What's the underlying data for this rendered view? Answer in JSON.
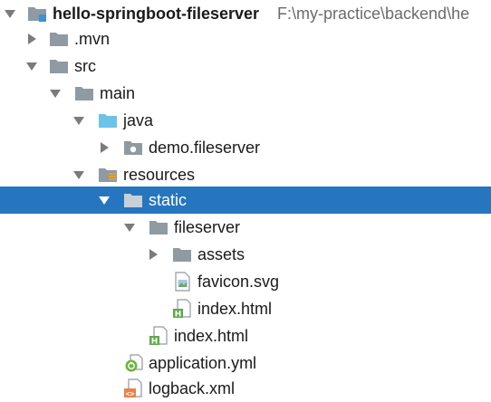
{
  "tree": {
    "root": {
      "label": "hello-springboot-fileserver",
      "path": "F:\\my-practice\\backend\\he",
      "icon": "module-folder-icon",
      "expanded": true
    },
    "mvn": {
      "label": ".mvn",
      "icon": "folder-icon",
      "expanded": false
    },
    "src": {
      "label": "src",
      "icon": "folder-icon",
      "expanded": true
    },
    "main": {
      "label": "main",
      "icon": "folder-icon",
      "expanded": true
    },
    "java": {
      "label": "java",
      "icon": "source-folder-icon",
      "expanded": true
    },
    "demo_fileserver": {
      "label": "demo.fileserver",
      "icon": "package-icon",
      "expanded": false
    },
    "resources": {
      "label": "resources",
      "icon": "resources-folder-icon",
      "expanded": true
    },
    "static": {
      "label": "static",
      "icon": "folder-icon",
      "expanded": true,
      "selected": true
    },
    "fileserver": {
      "label": "fileserver",
      "icon": "folder-icon",
      "expanded": true
    },
    "assets": {
      "label": "assets",
      "icon": "folder-icon",
      "expanded": false
    },
    "favicon": {
      "label": "favicon.svg",
      "icon": "image-file-icon"
    },
    "index_inner": {
      "label": "index.html",
      "icon": "html-file-icon"
    },
    "index_outer": {
      "label": "index.html",
      "icon": "html-file-icon"
    },
    "application": {
      "label": "application.yml",
      "icon": "spring-config-icon"
    },
    "logback": {
      "label": "logback.xml",
      "icon": "xml-file-icon"
    }
  },
  "colors": {
    "selection": "#2675bf",
    "folder": "#8f9aa3",
    "source_folder": "#6cc3e8",
    "html_badge": "#5fa84a",
    "spring": "#6db33f",
    "xml": "#e8844a"
  }
}
